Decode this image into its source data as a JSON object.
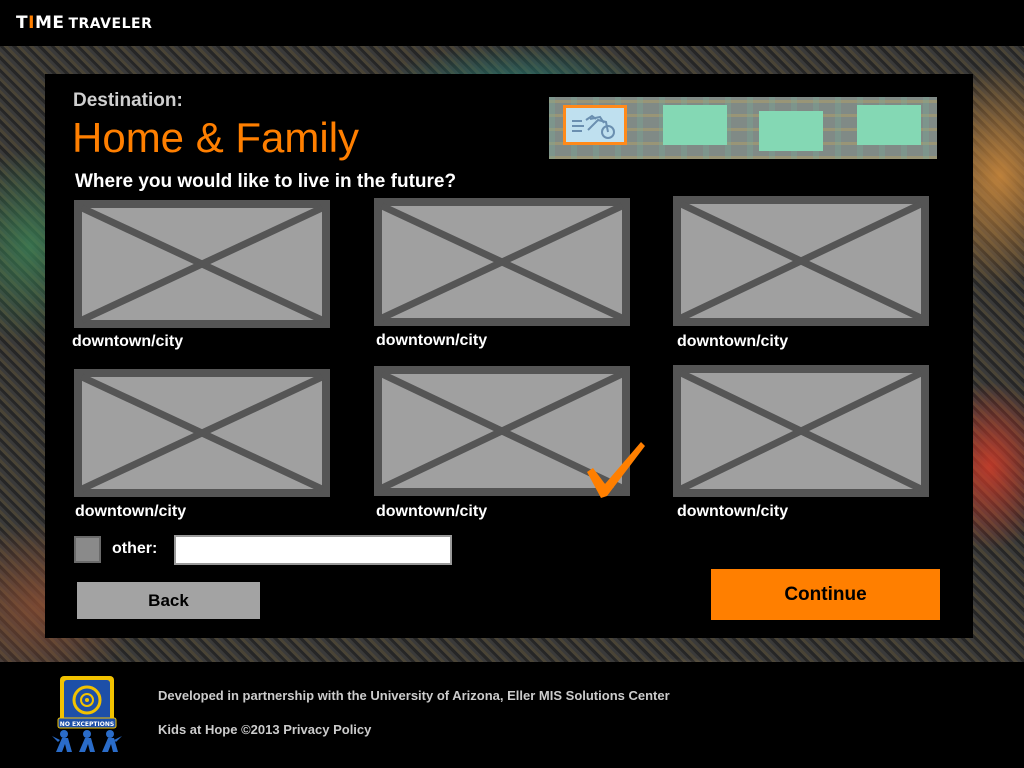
{
  "app": {
    "logo_time_1": "T",
    "logo_time_accent": "I",
    "logo_time_2": "ME",
    "logo_traveler": "TRAVELER"
  },
  "header": {
    "destination_label": "Destination:",
    "title": "Home & Family",
    "question": "Where you would like to live in the future?"
  },
  "progress": {
    "current_step": 1,
    "total_steps": 4
  },
  "options": [
    {
      "label": "downtown/city",
      "selected": false
    },
    {
      "label": "downtown/city",
      "selected": false
    },
    {
      "label": "downtown/city",
      "selected": false
    },
    {
      "label": "downtown/city",
      "selected": false
    },
    {
      "label": "downtown/city",
      "selected": true
    },
    {
      "label": "downtown/city",
      "selected": false
    }
  ],
  "other": {
    "label": "other:",
    "value": "",
    "checked": false
  },
  "buttons": {
    "back": "Back",
    "continue": "Continue"
  },
  "footer": {
    "credit": "Developed in partnership with the University of Arizona, Eller MIS Solutions Center",
    "copyright": "Kids at Hope ©2013",
    "privacy": "Privacy Policy",
    "logo_text": "NO EXCEPTIONS"
  },
  "colors": {
    "accent": "#ff7f00",
    "placeholder_gray": "#a0a0a0",
    "progress_step": "#84d8b4"
  }
}
